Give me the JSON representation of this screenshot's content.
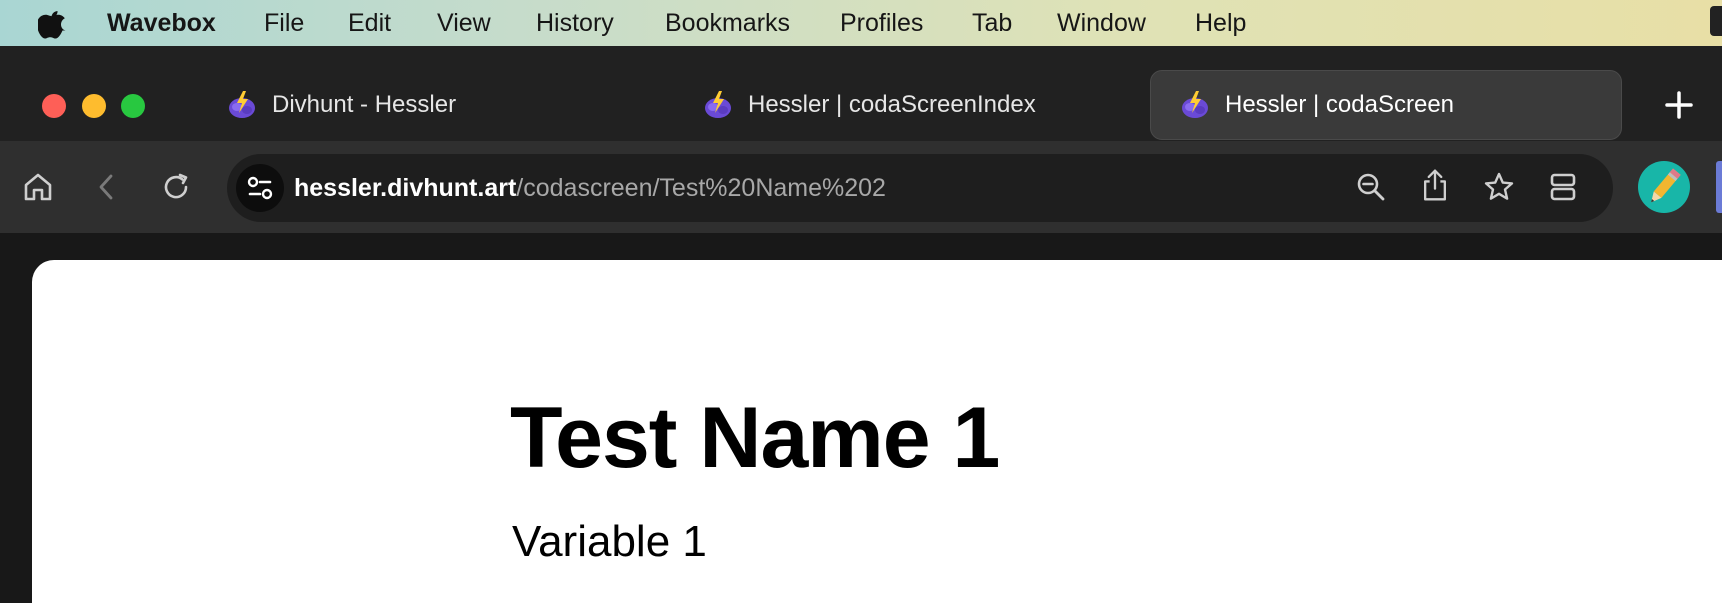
{
  "menubar": {
    "app_name": "Wavebox",
    "items": [
      "File",
      "Edit",
      "View",
      "History",
      "Bookmarks",
      "Profiles",
      "Tab",
      "Window",
      "Help"
    ]
  },
  "tabs": [
    {
      "title": "Divhunt - Hessler",
      "active": false
    },
    {
      "title": "Hessler | codaScreenIndex",
      "active": false
    },
    {
      "title": "Hessler | codaScreen",
      "active": true
    }
  ],
  "address_bar": {
    "host": "hessler.divhunt.art",
    "path": "/codascreen/Test%20Name%202"
  },
  "page": {
    "title": "Test Name 1",
    "subtitle": "Variable 1"
  },
  "colors": {
    "tab_strip": "#212121",
    "toolbar": "#2f2f2f",
    "url_field": "#1e1e1e",
    "traffic_red": "#fe5f57",
    "traffic_yellow": "#febc2e",
    "traffic_green": "#28c840",
    "avatar": "#18b6a8"
  },
  "icons": {
    "menubar": "apple-logo-icon",
    "tab_favicon": "brain-lightning-icon",
    "new_tab": "plus-icon",
    "home": "home-icon",
    "back": "chevron-left-icon",
    "reload": "reload-icon",
    "site_info": "sliders-icon",
    "zoom": "zoom-out-icon",
    "share": "share-icon",
    "bookmark": "star-icon",
    "split": "split-view-icon",
    "profile": "pencil-avatar-icon"
  }
}
